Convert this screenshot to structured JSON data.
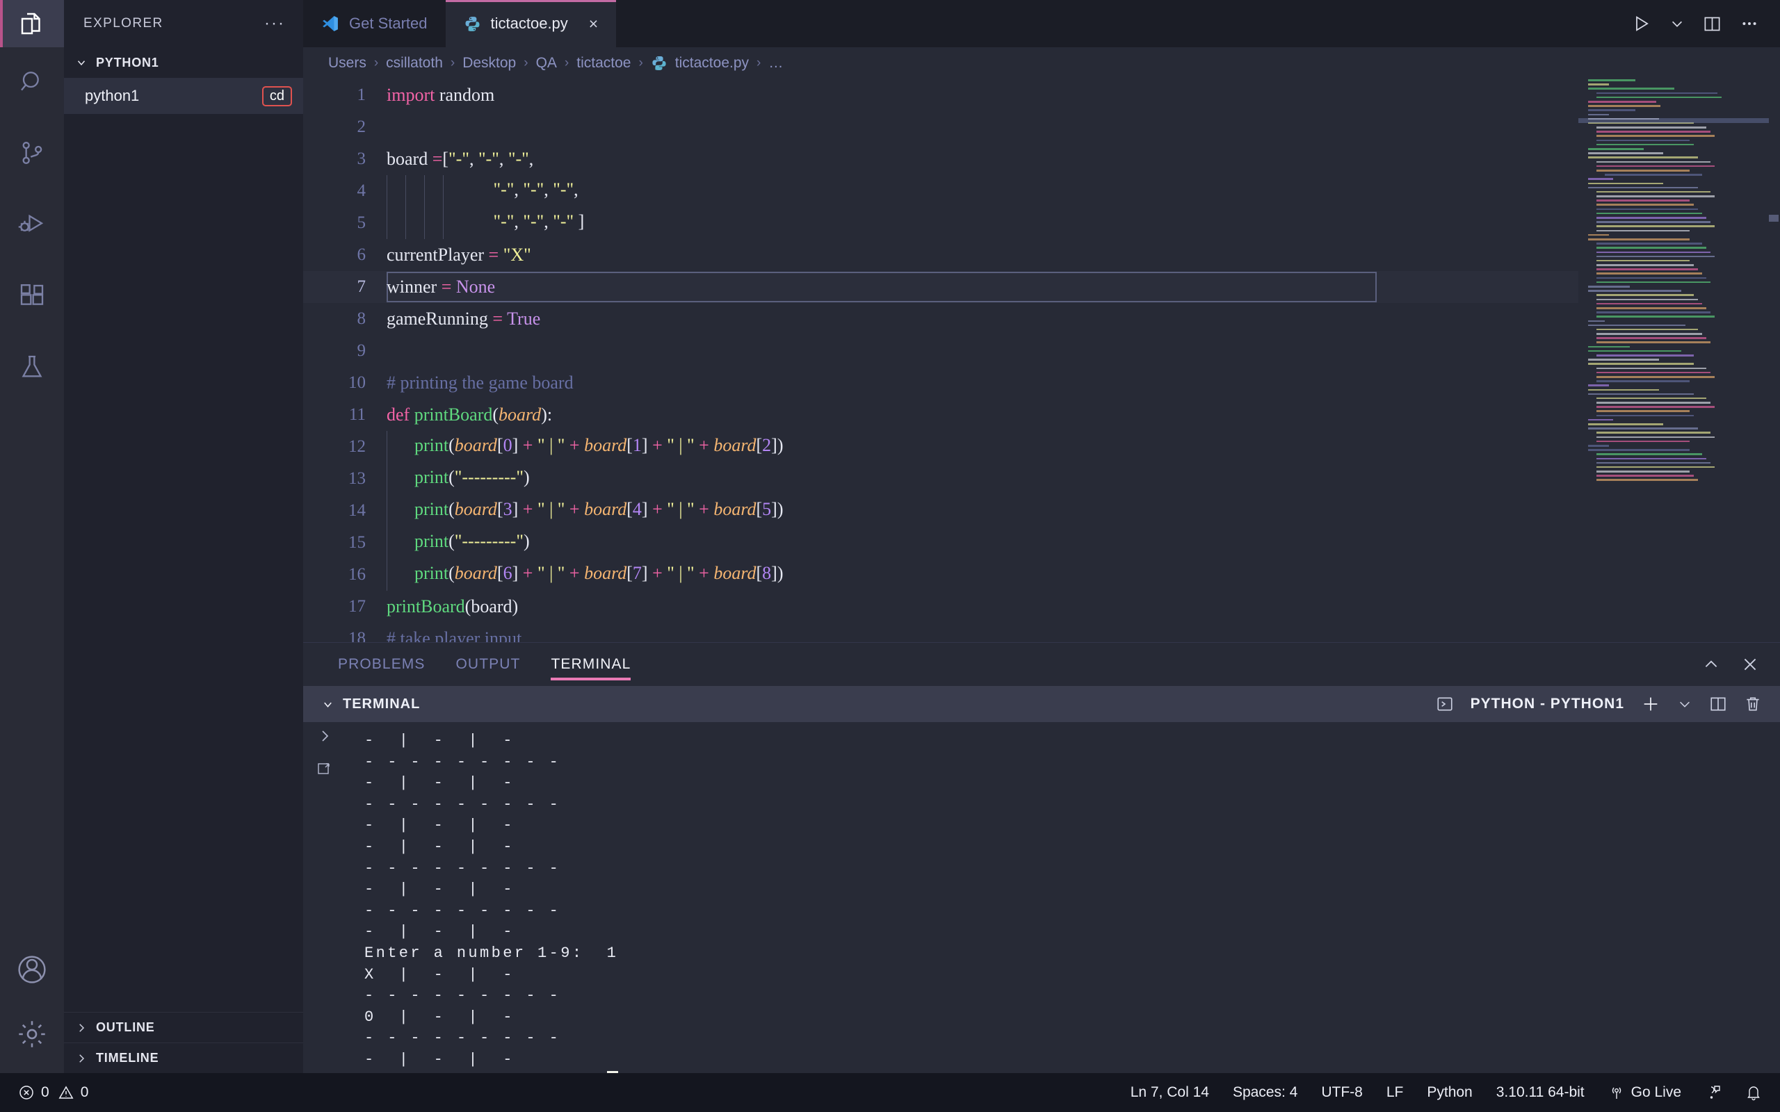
{
  "window": {
    "activity_bar": [
      {
        "name": "explorer",
        "icon": "files-icon",
        "active": true
      },
      {
        "name": "search",
        "icon": "search-icon",
        "active": false
      },
      {
        "name": "source-control",
        "icon": "source-control-icon",
        "active": false
      },
      {
        "name": "run-debug",
        "icon": "run-and-debug-icon",
        "active": false
      },
      {
        "name": "extensions",
        "icon": "extensions-icon",
        "active": false
      },
      {
        "name": "testing",
        "icon": "beaker-icon",
        "active": false
      }
    ],
    "activity_bar_bottom": [
      {
        "name": "accounts",
        "icon": "account-icon"
      },
      {
        "name": "settings",
        "icon": "gear-icon"
      }
    ]
  },
  "sidebar": {
    "title": "EXPLORER",
    "more_actions": "···",
    "folder": {
      "label": "PYTHON1",
      "expanded": true,
      "chevron": "chevron-down-icon"
    },
    "files": [
      {
        "label": "python1",
        "badge": "cd",
        "badge_color": "#e0524f",
        "selected": true
      }
    ],
    "sections": [
      {
        "label": "OUTLINE",
        "chevron": "chevron-right-icon"
      },
      {
        "label": "TIMELINE",
        "chevron": "chevron-right-icon"
      }
    ]
  },
  "tabs": [
    {
      "label": "Get Started",
      "icon": "vscode-logo-icon",
      "active": false,
      "closeable": false
    },
    {
      "label": "tictactoe.py",
      "icon": "python-file-icon",
      "active": true,
      "closeable": true,
      "close": "×"
    }
  ],
  "tab_actions": [
    {
      "name": "run-python-file-button",
      "icon": "play-icon"
    },
    {
      "name": "run-options-dropdown",
      "icon": "chevron-down-icon"
    },
    {
      "name": "split-editor-right-button",
      "icon": "split-editor-icon"
    },
    {
      "name": "more-actions-button",
      "icon": "ellipsis-icon"
    }
  ],
  "breadcrumb": {
    "separator": "›",
    "items": [
      "Users",
      "csillatoth",
      "Desktop",
      "QA",
      "tictactoe",
      "tictactoe.py",
      "…"
    ],
    "file_icon": "python-file-icon"
  },
  "editor": {
    "current_line": 7,
    "lines": [
      {
        "n": 1,
        "tokens": [
          {
            "t": "import",
            "c": "kw"
          },
          {
            "t": " random",
            "c": "plain"
          }
        ]
      },
      {
        "n": 2,
        "tokens": []
      },
      {
        "n": 3,
        "tokens": [
          {
            "t": "board ",
            "c": "plain"
          },
          {
            "t": "=",
            "c": "op"
          },
          {
            "t": "[",
            "c": "plain"
          },
          {
            "t": "\"-\"",
            "c": "str"
          },
          {
            "t": ", ",
            "c": "plain"
          },
          {
            "t": "\"-\"",
            "c": "str"
          },
          {
            "t": ", ",
            "c": "plain"
          },
          {
            "t": "\"-\"",
            "c": "str"
          },
          {
            "t": ",",
            "c": "plain"
          }
        ]
      },
      {
        "n": 4,
        "guides": 4,
        "tokens": [
          {
            "t": "       ",
            "c": "plain"
          },
          {
            "t": "\"-\"",
            "c": "str"
          },
          {
            "t": ", ",
            "c": "plain"
          },
          {
            "t": "\"-\"",
            "c": "str"
          },
          {
            "t": ", ",
            "c": "plain"
          },
          {
            "t": "\"-\"",
            "c": "str"
          },
          {
            "t": ",",
            "c": "plain"
          }
        ]
      },
      {
        "n": 5,
        "guides": 4,
        "tokens": [
          {
            "t": "       ",
            "c": "plain"
          },
          {
            "t": "\"-\"",
            "c": "str"
          },
          {
            "t": ", ",
            "c": "plain"
          },
          {
            "t": "\"-\"",
            "c": "str"
          },
          {
            "t": ", ",
            "c": "plain"
          },
          {
            "t": "\"-\"",
            "c": "str"
          },
          {
            "t": " ]",
            "c": "plain"
          }
        ]
      },
      {
        "n": 6,
        "tokens": [
          {
            "t": "currentPlayer ",
            "c": "plain"
          },
          {
            "t": "=",
            "c": "op"
          },
          {
            "t": " ",
            "c": "plain"
          },
          {
            "t": "\"X\"",
            "c": "str"
          }
        ]
      },
      {
        "n": 7,
        "tokens": [
          {
            "t": "winner ",
            "c": "plain"
          },
          {
            "t": "=",
            "c": "op"
          },
          {
            "t": " ",
            "c": "plain"
          },
          {
            "t": "None",
            "c": "const"
          }
        ]
      },
      {
        "n": 8,
        "tokens": [
          {
            "t": "gameRunning ",
            "c": "plain"
          },
          {
            "t": "=",
            "c": "op"
          },
          {
            "t": " ",
            "c": "plain"
          },
          {
            "t": "True",
            "c": "const"
          }
        ]
      },
      {
        "n": 9,
        "tokens": []
      },
      {
        "n": 10,
        "tokens": [
          {
            "t": "# printing the game board",
            "c": "com"
          }
        ]
      },
      {
        "n": 11,
        "tokens": [
          {
            "t": "def",
            "c": "kw"
          },
          {
            "t": " ",
            "c": "plain"
          },
          {
            "t": "printBoard",
            "c": "fn"
          },
          {
            "t": "(",
            "c": "plain"
          },
          {
            "t": "board",
            "c": "param"
          },
          {
            "t": "):",
            "c": "plain"
          }
        ]
      },
      {
        "n": 12,
        "guides": 1,
        "tokens": [
          {
            "t": "  ",
            "c": "plain"
          },
          {
            "t": "print",
            "c": "fn"
          },
          {
            "t": "(",
            "c": "plain"
          },
          {
            "t": "board",
            "c": "param"
          },
          {
            "t": "[",
            "c": "plain"
          },
          {
            "t": "0",
            "c": "num"
          },
          {
            "t": "] ",
            "c": "plain"
          },
          {
            "t": "+",
            "c": "op"
          },
          {
            "t": " ",
            "c": "plain"
          },
          {
            "t": "\" | \"",
            "c": "str"
          },
          {
            "t": " ",
            "c": "plain"
          },
          {
            "t": "+",
            "c": "op"
          },
          {
            "t": " ",
            "c": "plain"
          },
          {
            "t": "board",
            "c": "param"
          },
          {
            "t": "[",
            "c": "plain"
          },
          {
            "t": "1",
            "c": "num"
          },
          {
            "t": "] ",
            "c": "plain"
          },
          {
            "t": "+",
            "c": "op"
          },
          {
            "t": " ",
            "c": "plain"
          },
          {
            "t": "\" | \"",
            "c": "str"
          },
          {
            "t": " ",
            "c": "plain"
          },
          {
            "t": "+",
            "c": "op"
          },
          {
            "t": " ",
            "c": "plain"
          },
          {
            "t": "board",
            "c": "param"
          },
          {
            "t": "[",
            "c": "plain"
          },
          {
            "t": "2",
            "c": "num"
          },
          {
            "t": "])",
            "c": "plain"
          }
        ]
      },
      {
        "n": 13,
        "guides": 1,
        "tokens": [
          {
            "t": "  ",
            "c": "plain"
          },
          {
            "t": "print",
            "c": "fn"
          },
          {
            "t": "(",
            "c": "plain"
          },
          {
            "t": "\"---------\"",
            "c": "str"
          },
          {
            "t": ")",
            "c": "plain"
          }
        ]
      },
      {
        "n": 14,
        "guides": 1,
        "tokens": [
          {
            "t": "  ",
            "c": "plain"
          },
          {
            "t": "print",
            "c": "fn"
          },
          {
            "t": "(",
            "c": "plain"
          },
          {
            "t": "board",
            "c": "param"
          },
          {
            "t": "[",
            "c": "plain"
          },
          {
            "t": "3",
            "c": "num"
          },
          {
            "t": "] ",
            "c": "plain"
          },
          {
            "t": "+",
            "c": "op"
          },
          {
            "t": " ",
            "c": "plain"
          },
          {
            "t": "\" | \"",
            "c": "str"
          },
          {
            "t": " ",
            "c": "plain"
          },
          {
            "t": "+",
            "c": "op"
          },
          {
            "t": " ",
            "c": "plain"
          },
          {
            "t": "board",
            "c": "param"
          },
          {
            "t": "[",
            "c": "plain"
          },
          {
            "t": "4",
            "c": "num"
          },
          {
            "t": "] ",
            "c": "plain"
          },
          {
            "t": "+",
            "c": "op"
          },
          {
            "t": " ",
            "c": "plain"
          },
          {
            "t": "\" | \"",
            "c": "str"
          },
          {
            "t": " ",
            "c": "plain"
          },
          {
            "t": "+",
            "c": "op"
          },
          {
            "t": " ",
            "c": "plain"
          },
          {
            "t": "board",
            "c": "param"
          },
          {
            "t": "[",
            "c": "plain"
          },
          {
            "t": "5",
            "c": "num"
          },
          {
            "t": "])",
            "c": "plain"
          }
        ]
      },
      {
        "n": 15,
        "guides": 1,
        "tokens": [
          {
            "t": "  ",
            "c": "plain"
          },
          {
            "t": "print",
            "c": "fn"
          },
          {
            "t": "(",
            "c": "plain"
          },
          {
            "t": "\"---------\"",
            "c": "str"
          },
          {
            "t": ")",
            "c": "plain"
          }
        ]
      },
      {
        "n": 16,
        "guides": 1,
        "tokens": [
          {
            "t": "  ",
            "c": "plain"
          },
          {
            "t": "print",
            "c": "fn"
          },
          {
            "t": "(",
            "c": "plain"
          },
          {
            "t": "board",
            "c": "param"
          },
          {
            "t": "[",
            "c": "plain"
          },
          {
            "t": "6",
            "c": "num"
          },
          {
            "t": "] ",
            "c": "plain"
          },
          {
            "t": "+",
            "c": "op"
          },
          {
            "t": " ",
            "c": "plain"
          },
          {
            "t": "\" | \"",
            "c": "str"
          },
          {
            "t": " ",
            "c": "plain"
          },
          {
            "t": "+",
            "c": "op"
          },
          {
            "t": " ",
            "c": "plain"
          },
          {
            "t": "board",
            "c": "param"
          },
          {
            "t": "[",
            "c": "plain"
          },
          {
            "t": "7",
            "c": "num"
          },
          {
            "t": "] ",
            "c": "plain"
          },
          {
            "t": "+",
            "c": "op"
          },
          {
            "t": " ",
            "c": "plain"
          },
          {
            "t": "\" | \"",
            "c": "str"
          },
          {
            "t": " ",
            "c": "plain"
          },
          {
            "t": "+",
            "c": "op"
          },
          {
            "t": " ",
            "c": "plain"
          },
          {
            "t": "board",
            "c": "param"
          },
          {
            "t": "[",
            "c": "plain"
          },
          {
            "t": "8",
            "c": "num"
          },
          {
            "t": "])",
            "c": "plain"
          }
        ]
      },
      {
        "n": 17,
        "tokens": [
          {
            "t": "printBoard",
            "c": "fn"
          },
          {
            "t": "(board)",
            "c": "plain"
          }
        ]
      },
      {
        "n": 18,
        "tokens": [
          {
            "t": "# take player input",
            "c": "com"
          }
        ]
      }
    ]
  },
  "panel": {
    "tabs": [
      {
        "label": "PROBLEMS",
        "active": false
      },
      {
        "label": "OUTPUT",
        "active": false
      },
      {
        "label": "TERMINAL",
        "active": true
      }
    ],
    "actions": [
      {
        "name": "collapse-panel-button",
        "icon": "chevron-up-icon"
      },
      {
        "name": "close-panel-button",
        "icon": "close-icon"
      }
    ],
    "terminal": {
      "header_label": "TERMINAL",
      "chevron": "chevron-down-icon",
      "instance_name": "PYTHON - PYTHON1",
      "instance_icon": "terminal-icon",
      "header_actions": [
        {
          "name": "new-terminal-button",
          "icon": "plus-icon"
        },
        {
          "name": "terminal-type-dropdown",
          "icon": "chevron-down-icon"
        },
        {
          "name": "split-terminal-button",
          "icon": "split-icon"
        },
        {
          "name": "kill-terminal-button",
          "icon": "trash-icon"
        }
      ],
      "gutter_actions": [
        {
          "name": "expand-terminal-tabs-button",
          "icon": "chevron-right-icon"
        },
        {
          "name": "move-terminal-button",
          "icon": "move-panel-icon"
        }
      ],
      "output": [
        "-  |  -  |  -",
        "- - - - - - - - -",
        "-  |  -  |  -",
        "- - - - - - - - -",
        "-  |  -  |  -",
        "-  |  -  |  -",
        "- - - - - - - - -",
        "-  |  -  |  -",
        "- - - - - - - - -",
        "-  |  -  |  -",
        "Enter a number 1-9:  1",
        "X  |  -  |  -",
        "- - - - - - - - -",
        "0  |  -  |  -",
        "- - - - - - - - -",
        "-  |  -  |  -"
      ],
      "prompt": "Enter a number 1-9:  ",
      "cursor": true
    }
  },
  "status_bar": {
    "left": [
      {
        "name": "errors",
        "icon": "error-circle-icon",
        "value": "0"
      },
      {
        "name": "warnings",
        "icon": "warning-triangle-icon",
        "value": "0"
      }
    ],
    "right": [
      {
        "name": "editor-position",
        "label": "Ln 7, Col 14"
      },
      {
        "name": "indentation",
        "label": "Spaces: 4"
      },
      {
        "name": "encoding",
        "label": "UTF-8"
      },
      {
        "name": "eol",
        "label": "LF"
      },
      {
        "name": "language-mode",
        "label": "Python"
      },
      {
        "name": "python-interpreter",
        "label": "3.10.11 64-bit"
      },
      {
        "name": "go-live",
        "label": "Go Live",
        "icon": "broadcast-icon"
      },
      {
        "name": "feedback",
        "label": "",
        "icon": "feedback-icon"
      },
      {
        "name": "notifications",
        "label": "",
        "icon": "bell-icon"
      }
    ]
  },
  "colors": {
    "accent_pink": "#e87ab5",
    "badge_red": "#e0524f",
    "activity_active": "#b8538a",
    "editor_bg": "#272a36",
    "sidebar_bg": "#20222d",
    "status_bg": "#14161f"
  }
}
